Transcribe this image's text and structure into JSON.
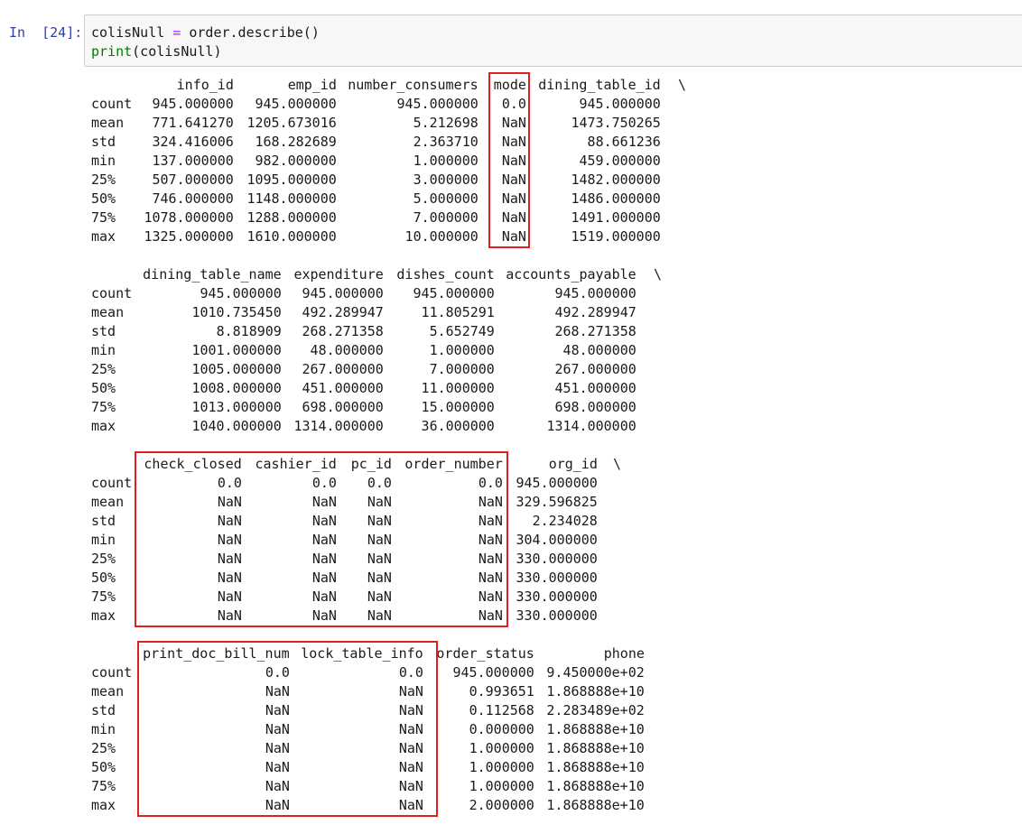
{
  "cell": {
    "prompt": "In  [24]:",
    "code": {
      "line1_var": "colisNull",
      "line1_op": " = ",
      "line1_rest": "order.describe()",
      "line2_fn": "print",
      "line2_rest": "(colisNull)"
    }
  },
  "output": {
    "index": [
      "count",
      "mean",
      "std",
      "min",
      "25%",
      "50%",
      "75%",
      "max"
    ],
    "continuation": "\\",
    "block1": {
      "columns": [
        "info_id",
        "emp_id",
        "number_consumers",
        "mode",
        "dining_table_id"
      ],
      "rows": [
        [
          "945.000000",
          "945.000000",
          "945.000000",
          "0.0",
          "945.000000"
        ],
        [
          "771.641270",
          "1205.673016",
          "5.212698",
          "NaN",
          "1473.750265"
        ],
        [
          "324.416006",
          "168.282689",
          "2.363710",
          "NaN",
          "88.661236"
        ],
        [
          "137.000000",
          "982.000000",
          "1.000000",
          "NaN",
          "459.000000"
        ],
        [
          "507.000000",
          "1095.000000",
          "3.000000",
          "NaN",
          "1482.000000"
        ],
        [
          "746.000000",
          "1148.000000",
          "5.000000",
          "NaN",
          "1486.000000"
        ],
        [
          "1078.000000",
          "1288.000000",
          "7.000000",
          "NaN",
          "1491.000000"
        ],
        [
          "1325.000000",
          "1610.000000",
          "10.000000",
          "NaN",
          "1519.000000"
        ]
      ]
    },
    "block2": {
      "columns": [
        "dining_table_name",
        "expenditure",
        "dishes_count",
        "accounts_payable"
      ],
      "rows": [
        [
          "945.000000",
          "945.000000",
          "945.000000",
          "945.000000"
        ],
        [
          "1010.735450",
          "492.289947",
          "11.805291",
          "492.289947"
        ],
        [
          "8.818909",
          "268.271358",
          "5.652749",
          "268.271358"
        ],
        [
          "1001.000000",
          "48.000000",
          "1.000000",
          "48.000000"
        ],
        [
          "1005.000000",
          "267.000000",
          "7.000000",
          "267.000000"
        ],
        [
          "1008.000000",
          "451.000000",
          "11.000000",
          "451.000000"
        ],
        [
          "1013.000000",
          "698.000000",
          "15.000000",
          "698.000000"
        ],
        [
          "1040.000000",
          "1314.000000",
          "36.000000",
          "1314.000000"
        ]
      ]
    },
    "block3": {
      "columns": [
        "check_closed",
        "cashier_id",
        "pc_id",
        "order_number",
        "org_id"
      ],
      "rows": [
        [
          "0.0",
          "0.0",
          "0.0",
          "0.0",
          "945.000000"
        ],
        [
          "NaN",
          "NaN",
          "NaN",
          "NaN",
          "329.596825"
        ],
        [
          "NaN",
          "NaN",
          "NaN",
          "NaN",
          "2.234028"
        ],
        [
          "NaN",
          "NaN",
          "NaN",
          "NaN",
          "304.000000"
        ],
        [
          "NaN",
          "NaN",
          "NaN",
          "NaN",
          "330.000000"
        ],
        [
          "NaN",
          "NaN",
          "NaN",
          "NaN",
          "330.000000"
        ],
        [
          "NaN",
          "NaN",
          "NaN",
          "NaN",
          "330.000000"
        ],
        [
          "NaN",
          "NaN",
          "NaN",
          "NaN",
          "330.000000"
        ]
      ]
    },
    "block4": {
      "columns": [
        "print_doc_bill_num",
        "lock_table_info",
        "order_status",
        "phone"
      ],
      "rows": [
        [
          "0.0",
          "0.0",
          "945.000000",
          "9.450000e+02"
        ],
        [
          "NaN",
          "NaN",
          "0.993651",
          "1.868888e+10"
        ],
        [
          "NaN",
          "NaN",
          "0.112568",
          "2.283489e+02"
        ],
        [
          "NaN",
          "NaN",
          "0.000000",
          "1.868888e+10"
        ],
        [
          "NaN",
          "NaN",
          "1.000000",
          "1.868888e+10"
        ],
        [
          "NaN",
          "NaN",
          "1.000000",
          "1.868888e+10"
        ],
        [
          "NaN",
          "NaN",
          "1.000000",
          "1.868888e+10"
        ],
        [
          "NaN",
          "NaN",
          "2.000000",
          "1.868888e+10"
        ]
      ]
    }
  },
  "highlight": {
    "color": "#e02020"
  }
}
